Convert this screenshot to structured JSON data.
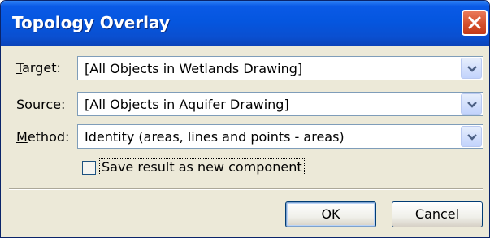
{
  "window": {
    "title": "Topology Overlay",
    "colors": {
      "titlebar": "#0556df",
      "dialog_bg": "#ece9d8",
      "close_btn": "#d4502d"
    }
  },
  "form": {
    "target": {
      "label": "Target:",
      "mnemonic": "T",
      "value": "[All Objects in Wetlands Drawing]"
    },
    "source": {
      "label": "Source:",
      "mnemonic": "S",
      "value": "[All Objects in Aquifer Drawing]"
    },
    "method": {
      "label": "Method:",
      "mnemonic": "M",
      "value": "Identity (areas, lines and points - areas)"
    },
    "save_new": {
      "label": "Save result as new component",
      "checked": false
    }
  },
  "buttons": {
    "ok": "OK",
    "cancel": "Cancel"
  },
  "icons": {
    "close": "close-icon",
    "dropdown": "chevron-down-icon"
  }
}
